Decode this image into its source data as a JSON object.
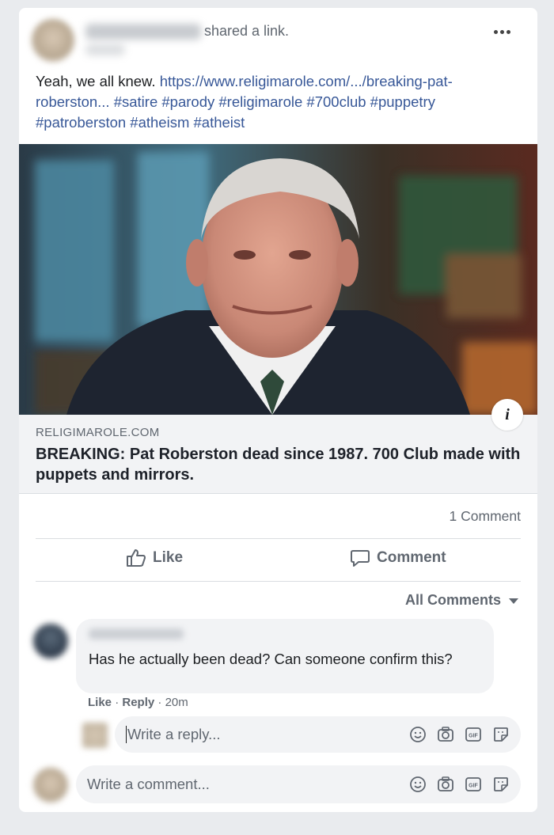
{
  "post": {
    "header_action": "shared a link.",
    "text_intro": "Yeah, we all knew.",
    "link_text": "https://www.religimarole.com/.../breaking-pat-roberston...",
    "hashtags": "#satire #parody #religimarole #700club #puppetry #patroberston #atheism #atheist"
  },
  "link_preview": {
    "domain": "RELIGIMAROLE.COM",
    "headline": "BREAKING: Pat Roberston dead since 1987. 700 Club made with puppets and mirrors."
  },
  "stats": {
    "comment_count": "1 Comment"
  },
  "actions": {
    "like_label": "Like",
    "comment_label": "Comment"
  },
  "comments_filter": {
    "label": "All Comments"
  },
  "comment": {
    "text": "Has he actually been dead? Can someone confirm this?",
    "like_label": "Like",
    "reply_label": "Reply",
    "time": "20m"
  },
  "reply_input": {
    "placeholder": "Write a reply..."
  },
  "comment_input": {
    "placeholder": "Write a comment..."
  },
  "icons": {
    "more": "more-horizontal-icon",
    "info": "info-icon",
    "like": "thumbs-up-icon",
    "comment": "speech-bubble-icon",
    "emoji": "smiley-icon",
    "camera": "camera-icon",
    "gif": "gif-icon",
    "sticker": "sticker-icon"
  },
  "colors": {
    "link": "#385898",
    "background": "#e9ebee",
    "secondary_text": "#606770"
  }
}
